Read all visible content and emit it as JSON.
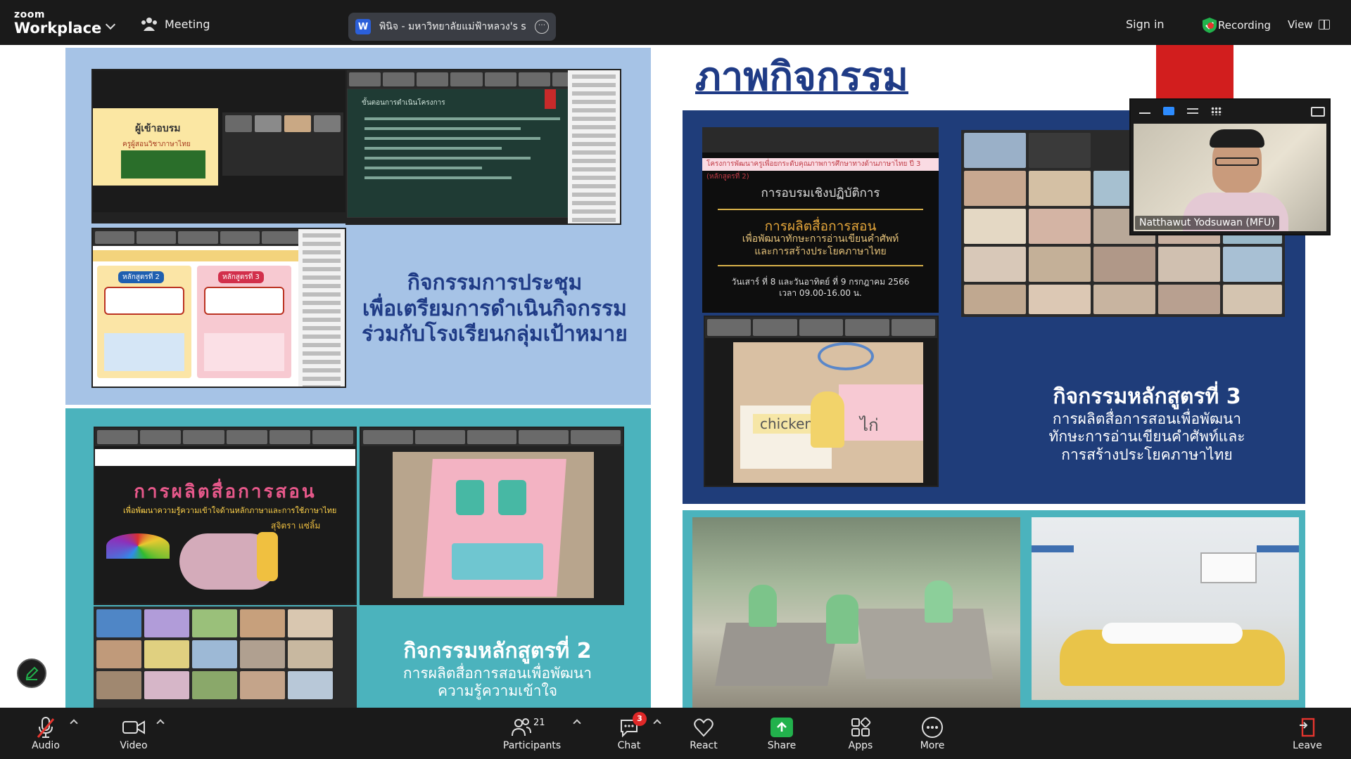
{
  "app": {
    "logo_line1": "zoom",
    "logo_line2": "Workplace"
  },
  "topbar": {
    "meeting_label": "Meeting",
    "share_tab_icon": "W",
    "share_tab_label": "พินิจ - มหาวิทยาลัยแม่ฟ้าหลวง's scree",
    "signin_label": "Sign in",
    "recording_label": "Recording",
    "view_label": "View"
  },
  "slide": {
    "title": "ภาพกิจกรรม",
    "caption_top_left": {
      "line1": "กิจกรรมการประชุม",
      "line2": "เพื่อเตรียมการดำเนินกิจกรรม",
      "line3": "ร่วมกับโรงเรียนกลุ่มเป้าหมาย"
    },
    "caption_bottom_left": {
      "heading": "กิจกรรมหลักสูตรที่ 2",
      "line1": "การผลิตสื่อการสอนเพื่อพัฒนา",
      "line2": "ความรู้ความเข้าใจ"
    },
    "caption_right": {
      "heading": "กิจกรรมหลักสูตรที่ 3",
      "line1": "การผลิตสื่อการสอนเพื่อพัฒนา",
      "line2": "ทักษะการอ่านเขียนคำศัพท์และ",
      "line3": "การสร้างประโยคภาษาไทย"
    },
    "board": {
      "banner": "โครงการพัฒนาครูเพื่อยกระดับคุณภาพการศึกษาทางด้านภาษาไทย ปี 3 (หลักสูตรที่ 2)",
      "line1": "การอบรมเชิงปฏิบัติการ",
      "line2": "การผลิตสื่อการสอน",
      "line3": "เพื่อพัฒนาทักษะการอ่านเขียนคำศัพท์",
      "line4": "และการสร้างประโยคภาษาไทย",
      "line5": "วันเสาร์ ที่ 8 และวันอาทิตย์ ที่ 9 กรกฎาคม 2566",
      "line6": "เวลา 09.00-16.00 น."
    },
    "inner_title_bl": "การผลิตสื่อการสอน",
    "inner_sub_bl": "เพื่อพัฒนาความรู้ความเข้าใจด้านหลักภาษาและการใช้ภาษาไทย",
    "inner_name_bl": "สุจิตรา แซ่ลิ้ม",
    "tl_inner_heading": "ผู้เข้าอบรม",
    "tl_inner_sub": "ครูผู้สอนวิชาภาษาไทย",
    "chalk_heading": "ขั้นตอนการดำเนินโครงการ",
    "craft_word_en": "chicken",
    "craft_word_th": "ไก่",
    "course2_label": "หลักสูตรที่ 2",
    "course3_label": "หลักสูตรที่ 3"
  },
  "selfview": {
    "name": "Natthawut Yodsuwan (MFU)"
  },
  "toolbar": {
    "audio": "Audio",
    "video": "Video",
    "participants": "Participants",
    "participants_count": "21",
    "chat": "Chat",
    "chat_badge": "3",
    "react": "React",
    "share": "Share",
    "apps": "Apps",
    "more": "More",
    "leave": "Leave"
  },
  "colors": {
    "accent_green": "#22b14c",
    "recording_red": "#e5352e",
    "slide_navy": "#1f3b86",
    "panel_blue": "#a6c3e6",
    "panel_teal": "#4bb3bd"
  }
}
